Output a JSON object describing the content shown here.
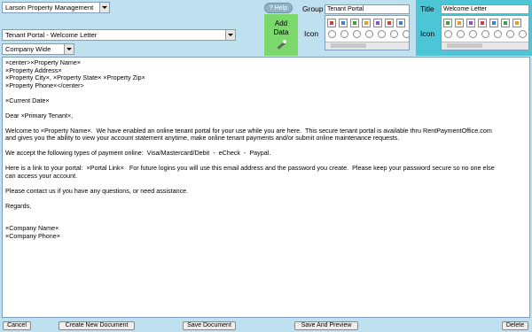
{
  "header": {
    "company_select": "Larson Property Management",
    "template_select": "Tenant Portal - Welcome Letter",
    "scope_select": "Company Wide",
    "help_label": "Help",
    "add_data_label": "Add Data"
  },
  "group": {
    "label": "Group",
    "value": "Tenant Portal",
    "icon_label": "Icon"
  },
  "title_panel": {
    "label": "Title",
    "value": "Welcome Letter",
    "icon_label": "Icon"
  },
  "editor": {
    "lines": [
      "×center>×Property Name×",
      "×Property Address×",
      "×Property City×, ×Property State× ×Property Zip×",
      "×Property Phone×</center>",
      "",
      "×Current Date×",
      "",
      "Dear ×Primary Tenant×,",
      "",
      "Welcome to ×Property Name×.  We have enabled an online tenant portal for your use while you are here.  This secure tenant portal is available thru RentPaymentOffice.com",
      "and gives you the ability to view your account statement anytime, make online tenant payments and/or submit online maintenance requests.",
      "",
      "We accept the following types of payment online:  Visa/Mastercard/Debit  -  eCheck  -  Paypal.",
      "",
      "Here is a link to your portal:  ×Portal Link×   For future logins you will use this email address and the password you create.  Please keep your password secure so no one else",
      "can access your account.",
      "",
      "Please contact us if you have any questions, or need assistance.",
      "",
      "Regards,",
      "",
      "",
      "×Company Name×",
      "×Company Phone×"
    ]
  },
  "footer": {
    "cancel": "Cancel",
    "create_new": "Create New Document",
    "save": "Save Document",
    "save_preview": "Save And Preview",
    "delete": "Delete"
  }
}
